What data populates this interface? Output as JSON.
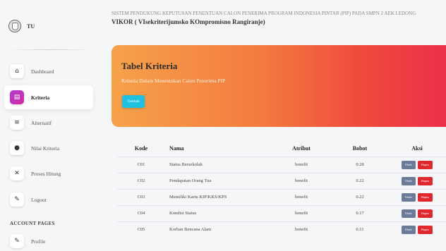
{
  "brand": {
    "name": "TU"
  },
  "sidebar": {
    "items": [
      {
        "label": "Dashboard",
        "icon": "home-icon",
        "glyph": "⌂"
      },
      {
        "label": "Kriteria",
        "icon": "document-icon",
        "glyph": "▤"
      },
      {
        "label": "Alternatif",
        "icon": "list-icon",
        "glyph": "≡"
      },
      {
        "label": "Nilai Kriteria",
        "icon": "circle-icon",
        "glyph": "●"
      },
      {
        "label": "Proses Hitung",
        "icon": "calculator-icon",
        "glyph": "✕"
      },
      {
        "label": "Logout",
        "icon": "user-icon",
        "glyph": "✎"
      },
      {
        "label": "Profile",
        "icon": "profile-icon",
        "glyph": "✎"
      }
    ],
    "section_label": "ACCOUNT PAGES"
  },
  "header": {
    "subtitle": "SISTEM PENDUKUNG KEPUTUSAN PENENTUAN CALON PENERIMA PROGRAM INDONESIA PINTAR (PIP) PADA SMPN 2 AEK LEDONG",
    "title": "VIKOR ( VIsekriterijumsko KOmpromisno Rangiranje)"
  },
  "banner": {
    "title": "Tabel Kriteria",
    "subtitle": "Kriteria Dalam Menentukan Calon Penerima PIP",
    "add_label": "Tambah"
  },
  "table": {
    "headers": {
      "kode": "Kode",
      "nama": "Nama",
      "atribut": "Atribut",
      "bobot": "Bobot",
      "aksi": "Aksi"
    },
    "edit_label": "Ubah",
    "delete_label": "Hapus",
    "rows": [
      {
        "kode": "C01",
        "nama": "Status Bersekolah",
        "atribut": "benefit",
        "bobot": "0.28"
      },
      {
        "kode": "C02",
        "nama": "Pendapatan Orang Tua",
        "atribut": "benefit",
        "bobot": "0.22"
      },
      {
        "kode": "C03",
        "nama": "Memiliki Kartu KIP/KKS/KPS",
        "atribut": "benefit",
        "bobot": "0.22"
      },
      {
        "kode": "C04",
        "nama": "Kondisi Status",
        "atribut": "benefit",
        "bobot": "0.17"
      },
      {
        "kode": "C05",
        "nama": "Korban Bencana Alam",
        "atribut": "benefit",
        "bobot": "0.11"
      }
    ]
  },
  "colors": {
    "accent": "#d12c9d",
    "button_info": "#1ec1e0",
    "button_edit": "#6c7a99",
    "button_delete": "#e0262f"
  }
}
